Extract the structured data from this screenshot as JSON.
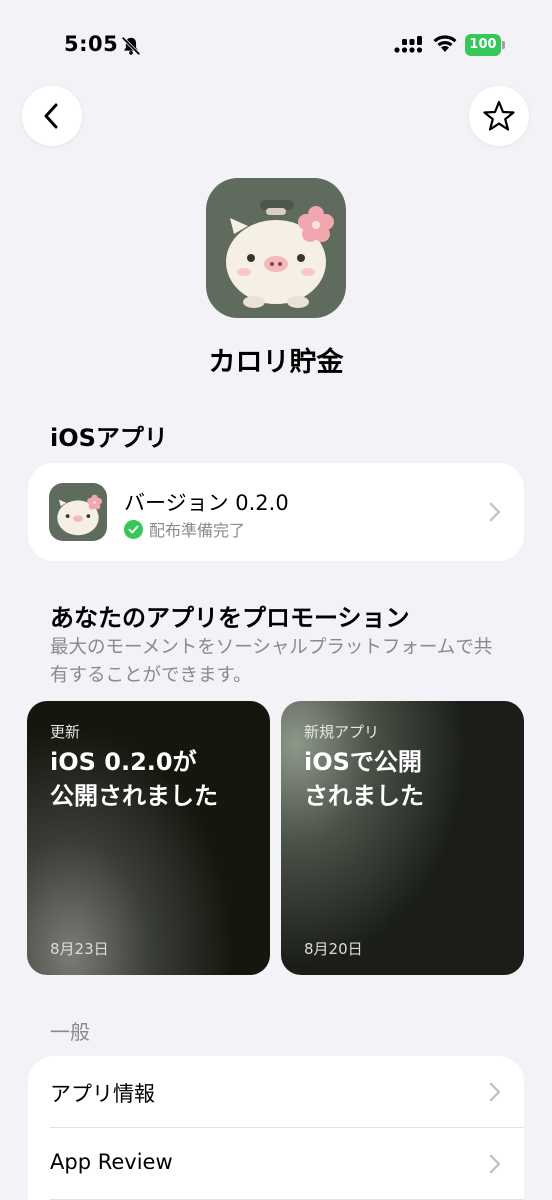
{
  "status_bar": {
    "time": "5:05",
    "battery": "100"
  },
  "app": {
    "name": "カロリ貯金"
  },
  "ios_section": {
    "title": "iOSアプリ",
    "version_label": "バージョン 0.2.0",
    "status": "配布準備完了"
  },
  "promotion": {
    "title": "あなたのアプリをプロモーション",
    "description": "最大のモーメントをソーシャルプラットフォームで共有することができます。",
    "cards": [
      {
        "tag": "更新",
        "line1": "iOS 0.2.0が",
        "line2": "公開されました",
        "date": "8月23日"
      },
      {
        "tag": "新規アプリ",
        "line1": "iOSで公開",
        "line2": "されました",
        "date": "8月20日"
      }
    ]
  },
  "general": {
    "title": "一般",
    "items": [
      {
        "label": "アプリ情報"
      },
      {
        "label": "App Review"
      }
    ]
  },
  "colors": {
    "background": "#f2f2f7",
    "app_icon_bg": "#5f6b5c",
    "success_green": "#34c759",
    "secondary_text": "#8a8a8e"
  },
  "icons": [
    "bell-slash-icon",
    "signal-icon",
    "wifi-icon",
    "battery-icon",
    "back-chevron-icon",
    "star-icon",
    "piggy-bank-icon",
    "checkmark-icon",
    "chevron-right-icon"
  ]
}
